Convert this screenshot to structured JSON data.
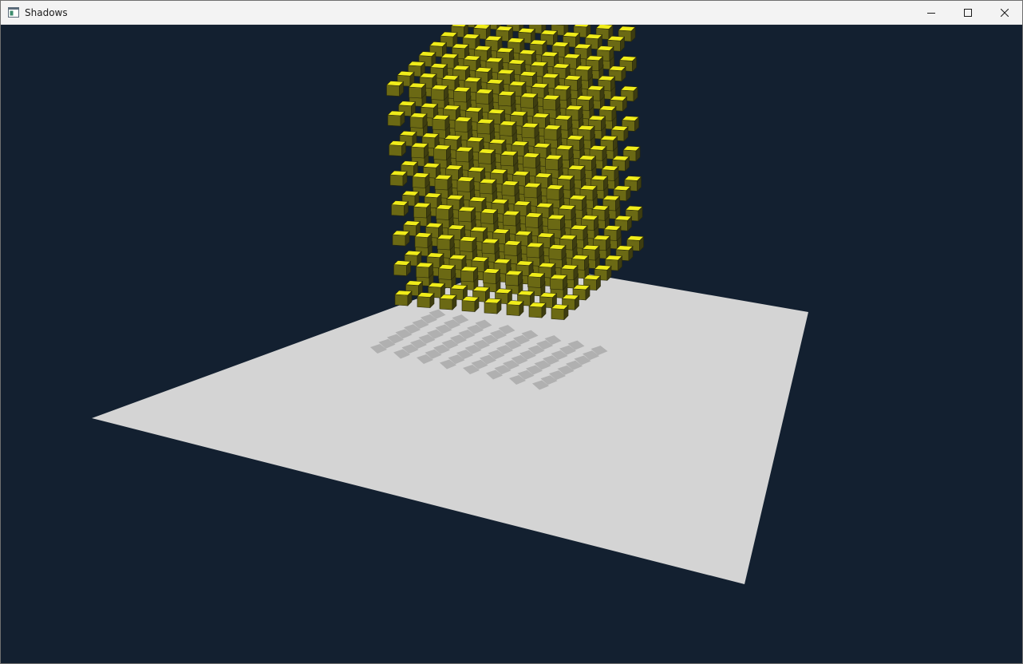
{
  "window": {
    "title": "Shadows",
    "icon": "app-window-icon",
    "controls": {
      "minimize_icon": "minimize-icon",
      "maximize_icon": "maximize-icon",
      "close_icon": "close-icon"
    }
  },
  "scene": {
    "background_color": "#132030",
    "plane_color": "#d4d4d4",
    "cube_top_color": "#f0ec1a",
    "cube_left_color": "#6b6914",
    "cube_right_color": "#3e3d10",
    "shadow_color": "#a9a9a9",
    "grid_size": 8
  }
}
